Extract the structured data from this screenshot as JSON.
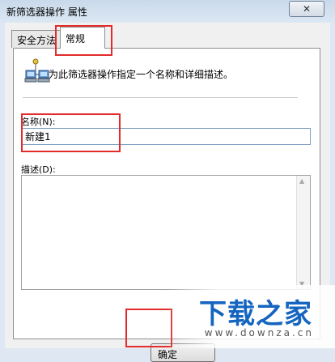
{
  "window": {
    "title": "新筛选器操作 属性",
    "close_label": "✕"
  },
  "tabs": [
    {
      "label": "安全方法"
    },
    {
      "label": "常规"
    }
  ],
  "general": {
    "intro_text": "为此筛选器操作指定一个名称和详细描述。",
    "name_label": "名称(N):",
    "name_value": "新建1",
    "desc_label": "描述(D):"
  },
  "buttons": {
    "ok_label": "确定"
  },
  "watermark": {
    "logo": "下载之家",
    "url": "www.downza.cn"
  },
  "colors": {
    "highlight": "#e32b2b",
    "watermark": "#1565c0"
  }
}
